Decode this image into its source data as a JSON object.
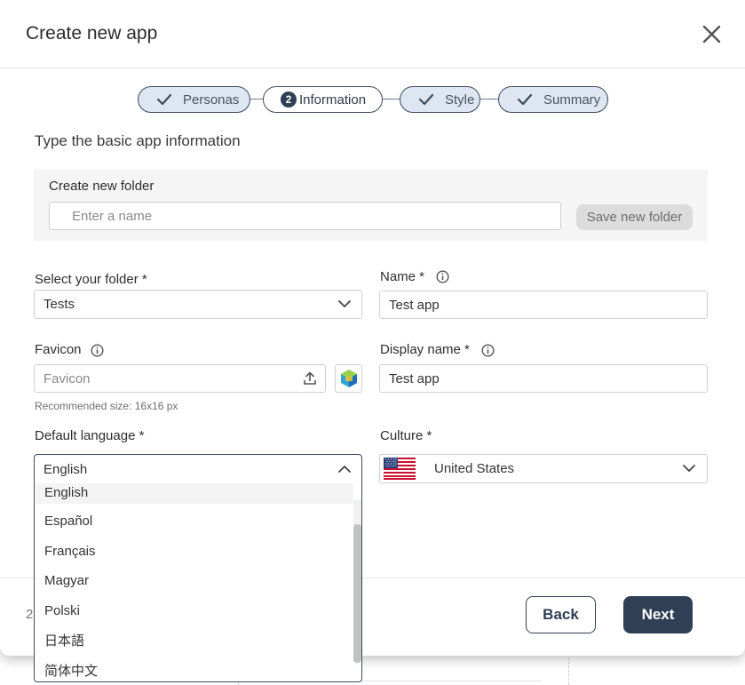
{
  "dialog": {
    "title": "Create new app"
  },
  "stepper": [
    {
      "label": "Personas",
      "state": "done"
    },
    {
      "label": "Information",
      "state": "active",
      "number": "2"
    },
    {
      "label": "Style",
      "state": "done"
    },
    {
      "label": "Summary",
      "state": "done"
    }
  ],
  "subtitle": "Type the basic app information",
  "create_folder": {
    "label": "Create new folder",
    "placeholder": "Enter a name",
    "save_label": "Save new folder"
  },
  "folder": {
    "label": "Select your folder *",
    "value": "Tests"
  },
  "name": {
    "label": "Name *",
    "value": "Test app"
  },
  "favicon": {
    "label": "Favicon",
    "placeholder": "Favicon",
    "hint": "Recommended size: 16x16 px"
  },
  "display_name": {
    "label": "Display name *",
    "value": "Test app"
  },
  "default_language": {
    "label": "Default language *",
    "value": "English",
    "options": [
      "English",
      "Español",
      "Français",
      "Magyar",
      "Polski",
      "日本語",
      "简体中文"
    ]
  },
  "culture": {
    "label": "Culture *",
    "value": "United States",
    "flag": "us-flag"
  },
  "footer": {
    "page_indicator": "2",
    "back_label": "Back",
    "next_label": "Next"
  },
  "colors": {
    "primary": "#2f3f55",
    "step_done_bg": "#dde6f1",
    "disabled_button_bg": "#dcdcdc"
  }
}
